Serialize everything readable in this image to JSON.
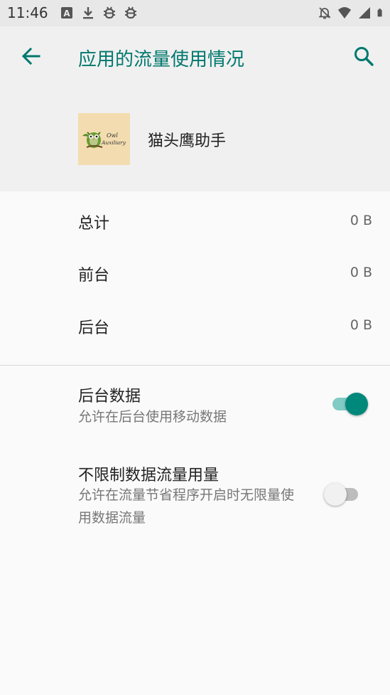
{
  "status_bar": {
    "time": "11:46",
    "left_icons": [
      "text-a-icon",
      "download-icon",
      "bug-icon",
      "bug-icon"
    ],
    "right_icons": [
      "notifications-off-icon",
      "wifi-icon",
      "signal-icon",
      "battery-icon"
    ]
  },
  "toolbar": {
    "title": "应用的流量使用情况",
    "accent_color": "#00786e"
  },
  "app": {
    "name": "猫头鹰助手",
    "icon_text_line1": "Owl",
    "icon_text_line2": "Auxiliary"
  },
  "usage": [
    {
      "label": "总计",
      "value": "0 B"
    },
    {
      "label": "前台",
      "value": "0 B"
    },
    {
      "label": "后台",
      "value": "0 B"
    }
  ],
  "settings": {
    "background_data": {
      "title": "后台数据",
      "summary": "允许在后台使用移动数据",
      "enabled": true
    },
    "unrestricted_data": {
      "title": "不限制数据流量用量",
      "summary": "允许在流量节省程序开启时无限量使用数据流量",
      "enabled": false
    }
  }
}
